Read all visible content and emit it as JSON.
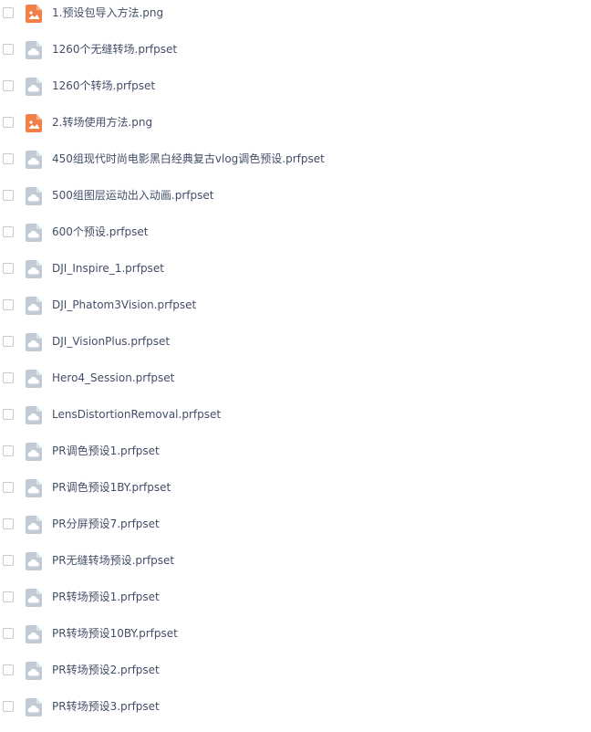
{
  "colors": {
    "text": "#424e67",
    "image_icon": "#f37f48",
    "preset_icon": "#c2cad6",
    "checkbox_border": "#c7c9cf"
  },
  "files": [
    {
      "name": "1.预设包导入方法.png",
      "icon": "image-file-icon"
    },
    {
      "name": "1260个无缝转场.prfpset",
      "icon": "generic-file-icon"
    },
    {
      "name": "1260个转场.prfpset",
      "icon": "generic-file-icon"
    },
    {
      "name": "2.转场使用方法.png",
      "icon": "image-file-icon"
    },
    {
      "name": "450组现代时尚电影黑白经典复古vlog调色预设.prfpset",
      "icon": "generic-file-icon"
    },
    {
      "name": "500组图层运动出入动画.prfpset",
      "icon": "generic-file-icon"
    },
    {
      "name": "600个预设.prfpset",
      "icon": "generic-file-icon"
    },
    {
      "name": "DJI_Inspire_1.prfpset",
      "icon": "generic-file-icon"
    },
    {
      "name": "DJI_Phatom3Vision.prfpset",
      "icon": "generic-file-icon"
    },
    {
      "name": "DJI_VisionPlus.prfpset",
      "icon": "generic-file-icon"
    },
    {
      "name": "Hero4_Session.prfpset",
      "icon": "generic-file-icon"
    },
    {
      "name": "LensDistortionRemoval.prfpset",
      "icon": "generic-file-icon"
    },
    {
      "name": "PR调色预设1.prfpset",
      "icon": "generic-file-icon"
    },
    {
      "name": "PR调色预设1BY.prfpset",
      "icon": "generic-file-icon"
    },
    {
      "name": "PR分屏预设7.prfpset",
      "icon": "generic-file-icon"
    },
    {
      "name": "PR无缝转场预设.prfpset",
      "icon": "generic-file-icon"
    },
    {
      "name": "PR转场预设1.prfpset",
      "icon": "generic-file-icon"
    },
    {
      "name": "PR转场预设10BY.prfpset",
      "icon": "generic-file-icon"
    },
    {
      "name": "PR转场预设2.prfpset",
      "icon": "generic-file-icon"
    },
    {
      "name": "PR转场预设3.prfpset",
      "icon": "generic-file-icon"
    }
  ]
}
